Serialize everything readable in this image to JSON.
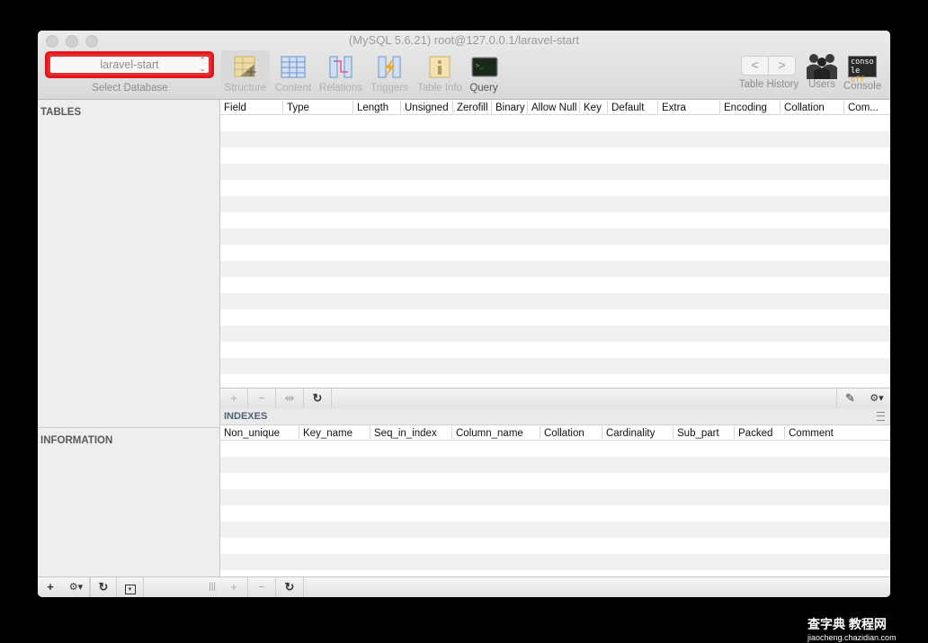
{
  "window": {
    "title": "(MySQL 5.6.21) root@127.0.0.1/laravel-start"
  },
  "database_selector": {
    "value": "laravel-start",
    "label": "Select Database",
    "highlight_color": "#e8141b"
  },
  "toolbar": {
    "views": [
      {
        "id": "structure",
        "label": "Structure",
        "icon": "structure-icon",
        "active": true
      },
      {
        "id": "content",
        "label": "Content",
        "icon": "content-icon",
        "active": false
      },
      {
        "id": "relations",
        "label": "Relations",
        "icon": "relations-icon",
        "active": false
      },
      {
        "id": "triggers",
        "label": "Triggers",
        "icon": "triggers-icon",
        "active": false
      },
      {
        "id": "table_info",
        "label": "Table Info",
        "icon": "table-info-icon",
        "active": false
      },
      {
        "id": "query",
        "label": "Query",
        "icon": "query-terminal-icon",
        "active": false
      }
    ],
    "history": {
      "label": "Table History",
      "back": "<",
      "forward": ">"
    },
    "users_label": "Users",
    "console": {
      "label": "Console",
      "icon_text_top": "conso",
      "icon_text_bottom_a": "le ",
      "icon_text_bottom_b": "off"
    }
  },
  "sidebar": {
    "tables_title": "TABLES",
    "information_title": "INFORMATION",
    "bottom_buttons": {
      "add": "+",
      "gear": "⚙▾",
      "refresh": "↻",
      "filter": "▾",
      "resize": "|||"
    }
  },
  "structure": {
    "columns": [
      "Field",
      "Type",
      "Length",
      "Unsigned",
      "Zerofill",
      "Binary",
      "Allow Null",
      "Key",
      "Default",
      "Extra",
      "Encoding",
      "Collation",
      "Com..."
    ],
    "rows": [],
    "toolbar": {
      "add": "+",
      "remove": "−",
      "duplicate": "⇹",
      "refresh": "↻",
      "edit": "✎",
      "gear": "⚙▾"
    }
  },
  "indexes": {
    "title": "INDEXES",
    "columns": [
      "Non_unique",
      "Key_name",
      "Seq_in_index",
      "Column_name",
      "Collation",
      "Cardinality",
      "Sub_part",
      "Packed",
      "Comment"
    ],
    "rows": [],
    "toolbar": {
      "add": "+",
      "remove": "−",
      "refresh": "↻"
    }
  },
  "watermark": {
    "top": "查字典 教程网",
    "bottom": "jiaocheng.chazidian.com"
  }
}
